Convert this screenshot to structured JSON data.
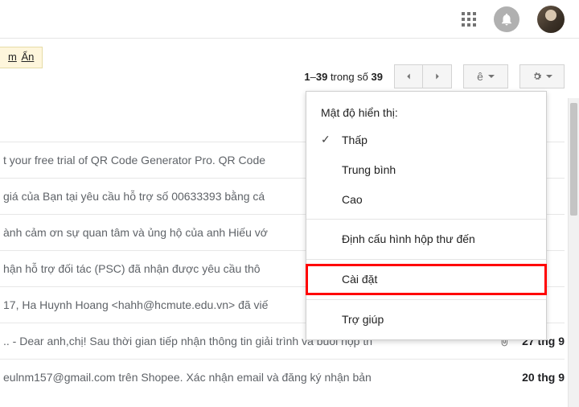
{
  "topbar": {
    "apps_icon": "apps-grid-icon",
    "bell_icon": "bell-icon",
    "avatar": "user-avatar"
  },
  "yellow_tab": {
    "frag1": "m",
    "frag2": "Ẩn"
  },
  "toolbar": {
    "count_prefix": "1",
    "count_dash": "–",
    "count_mid": "39",
    "count_sep": " trong số ",
    "count_total": "39",
    "lang_letter": "ê"
  },
  "menu": {
    "header": "Mật độ hiển thị:",
    "items": [
      {
        "label": "Thấp",
        "checked": true
      },
      {
        "label": "Trung bình",
        "checked": false
      },
      {
        "label": "Cao",
        "checked": false
      }
    ],
    "config_inbox": "Định cấu hình hộp thư đến",
    "settings": "Cài đặt",
    "help": "Trợ giúp"
  },
  "emails": [
    {
      "text": "t your free trial of QR Code Generator Pro. QR Code",
      "attachment": false,
      "date": ""
    },
    {
      "text": "giá của Bạn tại yêu cầu hỗ trợ số 00633393 bằng cá",
      "attachment": false,
      "date": ""
    },
    {
      "text": "ành cảm ơn sự quan tâm và ủng hộ của anh Hiếu vớ",
      "attachment": false,
      "date": ""
    },
    {
      "text": "hận hỗ trợ đối tác (PSC) đã nhận được yêu cầu thô",
      "attachment": false,
      "date": ""
    },
    {
      "text": "17, Ha Huynh Hoang <hahh@hcmute.edu.vn> đã viế",
      "attachment": false,
      "date": ""
    },
    {
      "text": ".. - Dear anh,chị! Sau thời gian tiếp nhận thông tin giải trình và buổi họp th",
      "attachment": true,
      "date": "27 thg 9"
    },
    {
      "text": "eulnm157@gmail.com trên Shopee. Xác nhận email và đăng ký nhận bản",
      "attachment": false,
      "date": "20 thg 9"
    }
  ]
}
